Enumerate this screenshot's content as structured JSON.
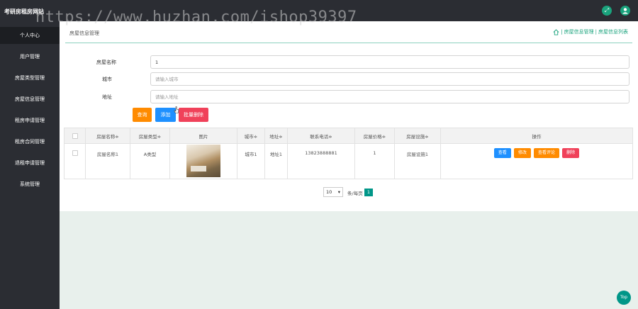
{
  "app": {
    "title": "考研房租房网站",
    "watermark": "https://www.huzhan.com/ishop39397"
  },
  "header_icons": [
    "expand-icon",
    "user-icon"
  ],
  "sidebar": {
    "items": [
      {
        "label": "个人中心",
        "active": true
      },
      {
        "label": "用户管理"
      },
      {
        "label": "房屋类型管理"
      },
      {
        "label": "房屋信息管理"
      },
      {
        "label": "租房申请管理"
      },
      {
        "label": "租房合同管理"
      },
      {
        "label": "退租申请管理"
      },
      {
        "label": "系统管理"
      }
    ]
  },
  "breadcrumb": {
    "title": "房屋信息管理",
    "path": [
      "房屋信息管理",
      "房屋信息列表"
    ],
    "separator": "|"
  },
  "search": {
    "name_label": "房屋名称",
    "name_value": "1",
    "city_label": "城市",
    "city_placeholder": "请输入城市",
    "address_label": "地址",
    "address_placeholder": "请输入地址"
  },
  "actions": {
    "search": "查询",
    "add": "添加",
    "batch_delete": "批量删除"
  },
  "table": {
    "columns": [
      "房屋名称≑",
      "房屋类型≑",
      "图片",
      "城市≑",
      "地址≑",
      "联系电话≑",
      "房屋价格≑",
      "房屋设施≑",
      "操作"
    ],
    "rows": [
      {
        "name": "房屋名称1",
        "type": "A类型",
        "city": "城市1",
        "address": "地址1",
        "phone": "13823888881",
        "price": "1",
        "facility": "房屋设施1"
      }
    ],
    "row_actions": {
      "view": "查看",
      "edit": "修改",
      "comments": "查看评论",
      "delete": "删除"
    }
  },
  "pager": {
    "page_size": "10",
    "unit": "条/每页",
    "current": "1"
  },
  "back_to_top": "Top",
  "colors": {
    "accent": "#1aa37d",
    "orange": "#ff8b00",
    "blue": "#1e90ff",
    "red": "#f0415a",
    "sidebar": "#2b2d33"
  }
}
